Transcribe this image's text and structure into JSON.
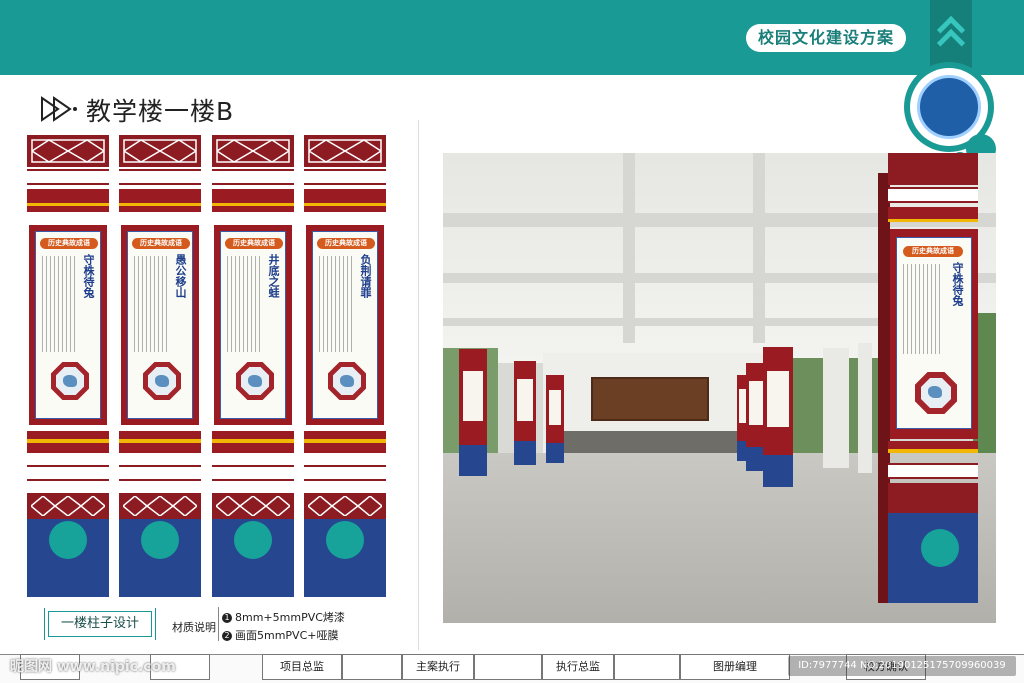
{
  "header": {
    "title": "校园文化建设方案"
  },
  "page": {
    "title": "教学楼一楼B"
  },
  "pillars": [
    {
      "tag": "历史典故成语",
      "heading": "守株待兔"
    },
    {
      "tag": "历史典故成语",
      "heading": "愚公移山"
    },
    {
      "tag": "历史典故成语",
      "heading": "井底之蛙"
    },
    {
      "tag": "历史典故成语",
      "heading": "负荆请罪"
    }
  ],
  "design_label": "一楼柱子设计",
  "materials": {
    "label": "材质说明",
    "items": [
      {
        "num": "1",
        "text": "8mm+5mmPVC烤漆"
      },
      {
        "num": "2",
        "text": "画面5mmPVC+哑膜"
      }
    ]
  },
  "photo": {
    "pillar_tag": "历史典故成语",
    "pillar_heading": "守株待兔"
  },
  "footer": {
    "cells": [
      "项目总监",
      "主案执行",
      "执行总监",
      "图册编理",
      "校方确认"
    ]
  },
  "watermarks": {
    "left": "昵图网 www.nipic.com",
    "right": "ID:7977744 NO:20190125175709960039"
  },
  "colors": {
    "teal": "#1a9a94",
    "maroon": "#9b1b22",
    "navy": "#26478f",
    "gold": "#f2b705"
  }
}
